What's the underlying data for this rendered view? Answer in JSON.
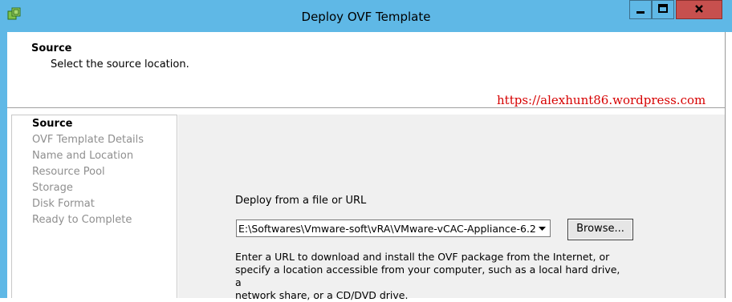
{
  "window": {
    "title": "Deploy OVF Template",
    "icon": "ovf-deploy-icon",
    "controls": {
      "minimize": "minimize-icon",
      "maximize": "maximize-icon",
      "close": "close-icon"
    },
    "accent": "#5fb8e6",
    "close_color": "#c7504e"
  },
  "header": {
    "title": "Source",
    "subtitle": "Select the source location."
  },
  "watermark": {
    "url": "https://alexhunt86.wordpress.com",
    "color": "#d60000"
  },
  "nav": {
    "items": [
      {
        "label": "Source",
        "active": true
      },
      {
        "label": "OVF Template Details",
        "active": false
      },
      {
        "label": "Name and Location",
        "active": false
      },
      {
        "label": "Resource Pool",
        "active": false
      },
      {
        "label": "Storage",
        "active": false
      },
      {
        "label": "Disk Format",
        "active": false
      },
      {
        "label": "Ready to Complete",
        "active": false
      }
    ]
  },
  "main": {
    "deploy_label": "Deploy from a file or URL",
    "source_value": "E:\\Softwares\\Vmware-soft\\vRA\\VMware-vCAC-Appliance-6.2",
    "browse_label": "Browse...",
    "help_line1": "Enter a URL to download and install the OVF package from the Internet, or",
    "help_line2": "specify a location accessible from your computer, such as a local hard drive, a",
    "help_line3": "network share, or a CD/DVD drive."
  }
}
